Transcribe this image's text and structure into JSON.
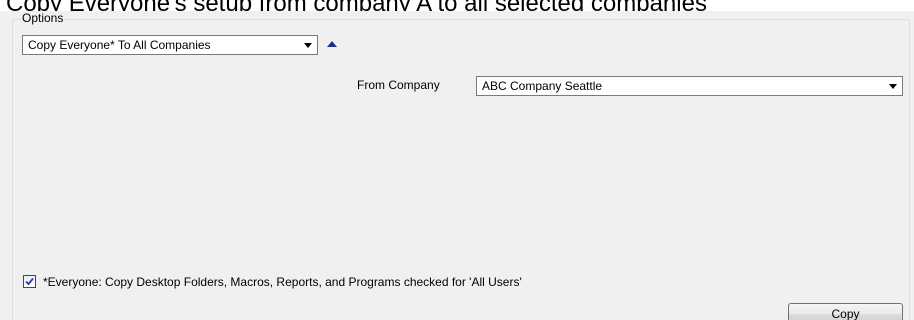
{
  "heading": "Copy Everyone's setup from company A to all selected companies",
  "options_group": {
    "legend": "Options",
    "mode_select": {
      "value": "Copy Everyone* To All Companies",
      "arrow_icon": "chevron-down-icon"
    },
    "collapse_icon": "triangle-up-icon",
    "from_company": {
      "label": "From Company",
      "value": "ABC Company Seattle",
      "arrow_icon": "chevron-down-icon"
    },
    "everyone_checkbox": {
      "checked": true,
      "label": "*Everyone: Copy Desktop Folders, Macros, Reports, and Programs checked for 'All Users'"
    },
    "copy_button": {
      "label": "Copy"
    }
  },
  "colors": {
    "panel_background": "#f0f0f0",
    "collapse_arrow": "#1d2f86",
    "groupbox_border": "#d5dfe5",
    "checkmark": "#21409a"
  }
}
